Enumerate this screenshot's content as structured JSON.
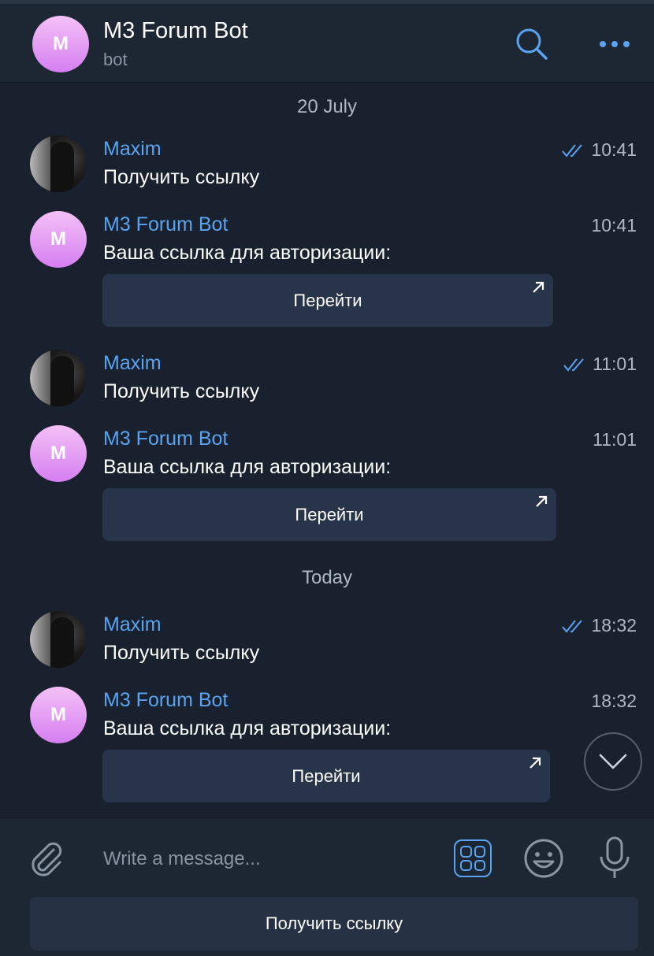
{
  "header": {
    "avatar_letter": "M",
    "title": "M3 Forum Bot",
    "subtitle": "bot"
  },
  "dates": [
    "20 July",
    "Today"
  ],
  "messages": [
    {
      "sender": "Maxim",
      "text": "Получить ссылку",
      "time": "10:41",
      "read": true
    },
    {
      "sender": "M3 Forum Bot",
      "avatar_letter": "M",
      "text": "Ваша ссылка для авторизации:",
      "time": "10:41",
      "button": "Перейти"
    },
    {
      "sender": "Maxim",
      "text": "Получить ссылку",
      "time": "11:01",
      "read": true
    },
    {
      "sender": "M3 Forum Bot",
      "avatar_letter": "M",
      "text": "Ваша ссылка для авторизации:",
      "time": "11:01",
      "button": "Перейти"
    },
    {
      "sender": "Maxim",
      "text": "Получить ссылку",
      "time": "18:32",
      "read": true
    },
    {
      "sender": "M3 Forum Bot",
      "avatar_letter": "M",
      "text": "Ваша ссылка для авторизации:",
      "time": "18:32",
      "button": "Перейти"
    }
  ],
  "composer": {
    "placeholder": "Write a message...",
    "reply_keyboard_button": "Получить ссылку"
  },
  "icons": {
    "search": "search-icon",
    "more": "more-dots-icon",
    "attach": "paperclip-icon",
    "keyboard": "bot-keyboard-icon",
    "emoji": "emoji-icon",
    "mic": "microphone-icon",
    "read": "double-check-icon",
    "external": "external-link-arrow-icon",
    "scroll": "chevron-down-icon"
  },
  "colors": {
    "background": "#18212d",
    "header": "#1d2633",
    "accent": "#5aa3f0",
    "button": "#27344a",
    "muted": "#aeb8c4"
  }
}
